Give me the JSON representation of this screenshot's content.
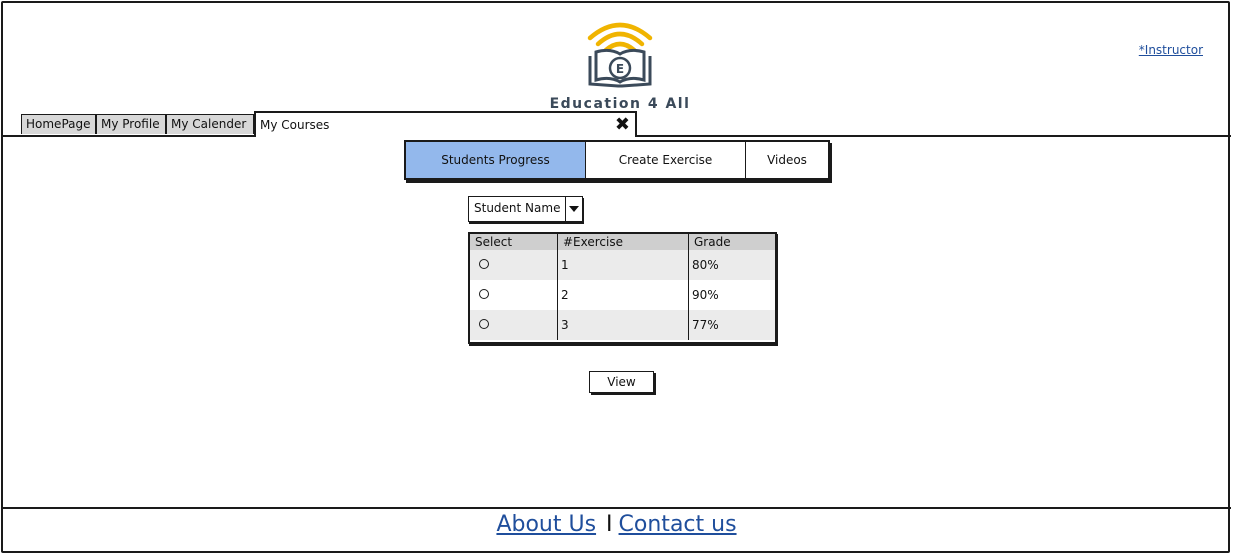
{
  "header": {
    "brand": "Education 4 All",
    "logo_letter": "E",
    "role_link": "*Instructor"
  },
  "tabs": [
    {
      "label": "HomePage"
    },
    {
      "label": "My Profile"
    },
    {
      "label": "My Calender"
    },
    {
      "label": "My Courses"
    }
  ],
  "subtabs": [
    {
      "label": "Students Progress"
    },
    {
      "label": "Create Exercise"
    },
    {
      "label": "Videos"
    }
  ],
  "student_select": {
    "value": "Student Name"
  },
  "table": {
    "headers": [
      "Select",
      "#Exercise",
      "Grade"
    ],
    "rows": [
      {
        "exercise": "1",
        "grade": "80%"
      },
      {
        "exercise": "2",
        "grade": "90%"
      },
      {
        "exercise": "3",
        "grade": "77%"
      }
    ]
  },
  "view_button": "View",
  "footer": {
    "about": "About Us",
    "separator": "I",
    "contact": "Contact us"
  },
  "colors": {
    "selected_subtab": "#93b8ec",
    "link": "#1f4e9c",
    "logo_gold": "#f0b400",
    "logo_dark": "#3b4a5a"
  }
}
